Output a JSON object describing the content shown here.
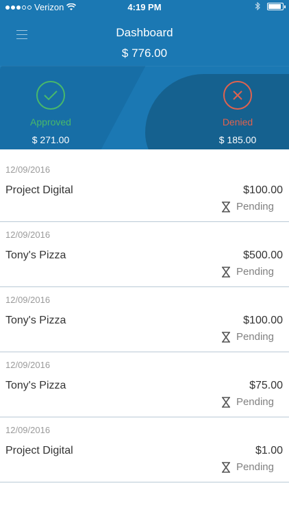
{
  "status_bar": {
    "carrier": "Verizon",
    "time": "4:19 PM"
  },
  "header": {
    "title": "Dashboard",
    "total": "$ 776.00"
  },
  "summary": {
    "approved": {
      "label": "Approved",
      "amount": "$ 271.00",
      "color": "#48b86b"
    },
    "denied": {
      "label": "Denied",
      "amount": "$ 185.00",
      "color": "#e0624f"
    }
  },
  "transactions": [
    {
      "date": "12/09/2016",
      "name": "Project Digital",
      "amount": "$100.00",
      "status": "Pending"
    },
    {
      "date": "12/09/2016",
      "name": "Tony's Pizza",
      "amount": "$500.00",
      "status": "Pending"
    },
    {
      "date": "12/09/2016",
      "name": "Tony's Pizza",
      "amount": "$100.00",
      "status": "Pending"
    },
    {
      "date": "12/09/2016",
      "name": "Tony's Pizza",
      "amount": "$75.00",
      "status": "Pending"
    },
    {
      "date": "12/09/2016",
      "name": "Project Digital",
      "amount": "$1.00",
      "status": "Pending"
    }
  ],
  "colors": {
    "header_bg": "#1b78b3",
    "accent_green": "#48b86b",
    "accent_red": "#e0624f"
  }
}
